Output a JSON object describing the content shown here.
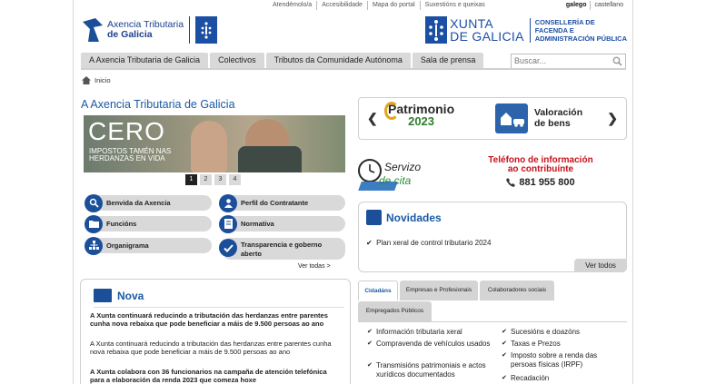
{
  "topbar": {
    "links": [
      "Atendémolo/a",
      "Accesibilidade",
      "Mapa do portal",
      "Suxestións e queixas"
    ],
    "languages": [
      "galego",
      "castellano"
    ]
  },
  "header": {
    "agency_line1": "Axencia Tributaria",
    "agency_line2": "de Galicia",
    "xunta_line1": "XUNTA",
    "xunta_line2": "DE GALICIA",
    "dept_line1": "CONSELLERÍA DE",
    "dept_line2": "FACENDA E",
    "dept_line3": "ADMINISTRACIÓN PÚBLICA"
  },
  "nav": {
    "items": [
      "A Axencia Tributaria de Galicia",
      "Colectivos",
      "Tributos da Comunidade Autónoma",
      "Sala de prensa"
    ],
    "search_placeholder": "Buscar..."
  },
  "breadcrumb": {
    "home": "Inicio"
  },
  "main": {
    "title": "A Axencia Tributaria de Galicia",
    "slider": {
      "headline": "CERO",
      "subtitle": "IMPOSTOS TAMÉN NAS HERDANZAS EN VIDA",
      "pages": [
        "1",
        "2",
        "3",
        "4"
      ],
      "active_page": 1
    },
    "quick_links": [
      "Benvida da Axencia",
      "Perfil do Contratante",
      "Funcións",
      "Normativa",
      "Organigrama",
      "Transparencia e goberno aberto"
    ],
    "see_all": "Ver todas >"
  },
  "nova": {
    "title": "Nova",
    "items": [
      {
        "title": "A Xunta continuará reducindo a tributación das herdanzas entre parentes cunha nova rebaixa que pode beneficiar a máis de 9.500 persoas ao ano",
        "summary": "A Xunta continuará reducindo a tributación das herdanzas entre parentes cunha nova rebaixa que pode beneficiar a máis de 9.500 persoas ao ano"
      },
      {
        "title": "A Xunta colabora con 36 funcionarios na campaña de atención telefónica para a elaboración da renda 2023 que comeza hoxe"
      }
    ]
  },
  "promo": {
    "patrimonio_word": "Patrimonio",
    "patrimonio_year": "2023",
    "valoracion_line1": "Valoración",
    "valoracion_line2": "de bens",
    "servizo_line1": "Servizo",
    "servizo_line2": "de cita",
    "phone_title_line1": "Teléfono de información",
    "phone_title_line2": "ao contribuínte",
    "phone_number": "881 955 800"
  },
  "novidades": {
    "title": "Novidades",
    "item": "Plan xeral de control tributario 2024",
    "see_all": "Ver todos"
  },
  "tabs": {
    "labels": [
      "Cidadáns",
      "Empresas e Profesionais",
      "Colaboradores sociais",
      "Empregados Públicos"
    ],
    "active": "Cidadáns",
    "col1": [
      "Información tributaria xeral",
      "Compravenda de vehículos usados",
      "Transmisións patrimoniais e actos xurídicos documentados"
    ],
    "col2": [
      "Sucesións e doazóns",
      "Taxas e Prezos",
      "Imposto sobre a renda das persoas físicas (IRPF)",
      "Recadación"
    ]
  },
  "colors": {
    "brand_blue": "#1b4fa3",
    "link_blue": "#1a5aa3",
    "phone_red": "#c8101a",
    "nav_grey": "#d9d9d9"
  }
}
